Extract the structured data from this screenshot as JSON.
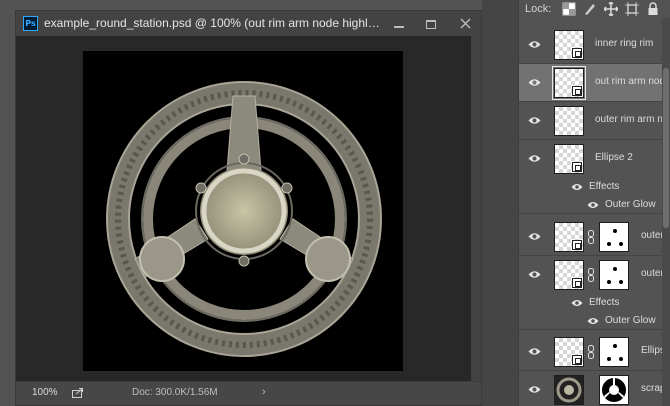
{
  "document": {
    "ps_badge": "Ps",
    "title": "example_round_station.psd @ 100% (out rim arm node highl…",
    "zoom": "100%",
    "doc_info": "Doc: 300.0K/1.56M",
    "status_arrow": "›"
  },
  "layers_panel": {
    "lock_label": "Lock:",
    "lock_icons": [
      "lock-transparent-pixels-icon",
      "lock-image-pixels-icon",
      "lock-position-icon",
      "lock-artboard-icon",
      "lock-all-icon"
    ],
    "layers": [
      {
        "name": "inner ring rim",
        "selected": false,
        "has_mask": false
      },
      {
        "name": "out rim arm node",
        "selected": true,
        "has_mask": false
      },
      {
        "name": "outer rim arm node",
        "selected": false,
        "has_mask": false
      },
      {
        "name": "Ellipse 2",
        "selected": false,
        "has_mask": false,
        "effects": "Effects",
        "effect_items": [
          "Outer Glow"
        ]
      },
      {
        "name": "outer w",
        "selected": false,
        "has_mask": true
      },
      {
        "name": "outer w",
        "selected": false,
        "has_mask": true,
        "effects": "Effects",
        "effect_items": [
          "Outer Glow"
        ]
      },
      {
        "name": "Ellipse",
        "selected": false,
        "has_mask": true
      },
      {
        "name": "scrap",
        "selected": false,
        "has_mask": true
      }
    ]
  },
  "colors": {
    "workspace": "#535353",
    "canvas_bg": "#000000",
    "selected_row": "#727272",
    "ps_accent": "#31a8ff"
  }
}
